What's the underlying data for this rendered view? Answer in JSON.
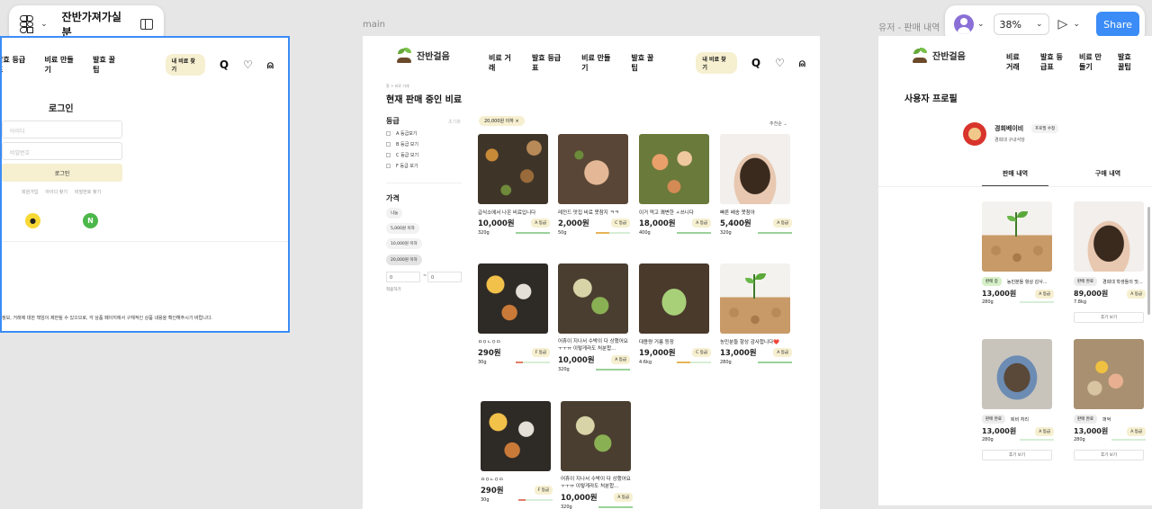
{
  "toolbar": {
    "file_name": "잔반가져가실분",
    "zoom": "38%",
    "share_label": "Share"
  },
  "frame_labels": {
    "main": "main",
    "profile": "유저 - 판매 내역"
  },
  "brand": {
    "name": "잔반걸음"
  },
  "nav": {
    "items": [
      "비료 거래",
      "발효 등급표",
      "비료 만들기",
      "발효 꿀팁"
    ],
    "my_fertilizer": "내 비료 찾기"
  },
  "login": {
    "title": "로그인",
    "id_placeholder": "아이디",
    "pw_placeholder": "비밀번호",
    "submit": "로그인",
    "links": [
      "회원가입",
      "아이디 찾기",
      "비밀번호 찾기"
    ],
    "notice": "정보, 거래에 대한 책임이 제한될 수 있으므로, 각 상품 페이지에서 구체적인 상품 내용을 확인해주시기 바랍니다."
  },
  "main": {
    "breadcrumb": "홈 > 비료 거래",
    "title": "현재 판매 중인 비료",
    "filter_grade_title": "등급",
    "filter_reset": "초기화",
    "grade_options": [
      "A 등급보기",
      "B 등급 보기",
      "C 등급 보기",
      "F 등급 보기"
    ],
    "filter_price_title": "가격",
    "price_options": [
      "나눔",
      "5,000원 이하",
      "10,000원 이하",
      "20,000원 이하"
    ],
    "price_min": "0",
    "price_sep": "~",
    "price_max": "0",
    "price_apply": "적용하기",
    "active_filter": "20,000원 이하",
    "active_filter_remove": "×",
    "sort_label": "추천순",
    "products": [
      {
        "title": "급식소에서 나온 비료입니다",
        "price": "10,000원",
        "grade": "A 등급",
        "weight": "320g",
        "bar_color": "#9ad29a",
        "bar_fill": 1.0
      },
      {
        "title": "레전드 맛집 비료 못참지 ㅋㅋ",
        "price": "2,000원",
        "grade": "C 등급",
        "weight": "50g",
        "bar_color": "#e7b458",
        "bar_fill": 0.4
      },
      {
        "title": "이거 먹고 쾌변한 ㅅ쓰니다",
        "price": "18,000원",
        "grade": "A 등급",
        "weight": "400g",
        "bar_color": "#9ad29a",
        "bar_fill": 1.0
      },
      {
        "title": "빠른 배송 못참아",
        "price": "5,400원",
        "grade": "A 등급",
        "weight": "320g",
        "bar_color": "#9ad29a",
        "bar_fill": 1.0
      },
      {
        "title": "ㅁㅇㄴㅇㅁ",
        "price": "290원",
        "grade": "F 등급",
        "weight": "30g",
        "bar_color": "#e37b6a",
        "bar_fill": 0.2
      },
      {
        "title": "어휴이 지나서 수박이 다 상했어요 ㅜㅜㅠ 이렇게라도 처분합...",
        "price": "10,000원",
        "grade": "A 등급",
        "weight": "320g",
        "bar_color": "#9ad29a",
        "bar_fill": 1.0
      },
      {
        "title": "대용량 거름 등장",
        "price": "19,000원",
        "grade": "C 등급",
        "weight": "4.6kg",
        "bar_color": "#e7b458",
        "bar_fill": 0.4
      },
      {
        "title": "농민분들 항상 감사합니다❤️",
        "price": "13,000원",
        "grade": "A 등급",
        "weight": "280g",
        "bar_color": "#9ad29a",
        "bar_fill": 1.0
      },
      {
        "title": "ㅁㅇㄴㅇㅁ",
        "price": "290원",
        "grade": "F 등급",
        "weight": "30g",
        "bar_color": "#e37b6a",
        "bar_fill": 0.2
      },
      {
        "title": "어휴이 지나서 수박이 다 상했어요 ㅜㅜㅠ 이렇게라도 처분합...",
        "price": "10,000원",
        "grade": "A 등급",
        "weight": "320g",
        "bar_color": "#9ad29a",
        "bar_fill": 1.0
      }
    ]
  },
  "profile": {
    "title": "사용자 프로필",
    "name": "경희베이비",
    "edit": "프로필 수정",
    "sub": "경희대 구내식당",
    "tabs": [
      "판매 내역",
      "구매 내역"
    ],
    "cards": [
      {
        "status": "판매 중",
        "status_bg": "#d6f0c8",
        "title": "농민분들 항상 감사...",
        "price": "13,000원",
        "grade": "A 등급",
        "weight": "280g",
        "review": ""
      },
      {
        "status": "판매 완료",
        "status_bg": "#ececec",
        "title": "경희대 학생들의 맛...",
        "price": "89,000원",
        "grade": "A 등급",
        "weight": "7.8kg",
        "review": "후기 보기"
      },
      {
        "status": "판매 완료",
        "status_bg": "#ececec",
        "title": "퇴비 처리",
        "price": "13,000원",
        "grade": "A 등급",
        "weight": "280g",
        "review": "후기 보기"
      },
      {
        "status": "판매 완료",
        "status_bg": "#ececec",
        "title": "퍼억",
        "price": "13,000원",
        "grade": "A 등급",
        "weight": "280g",
        "review": "후기 보기"
      }
    ]
  }
}
